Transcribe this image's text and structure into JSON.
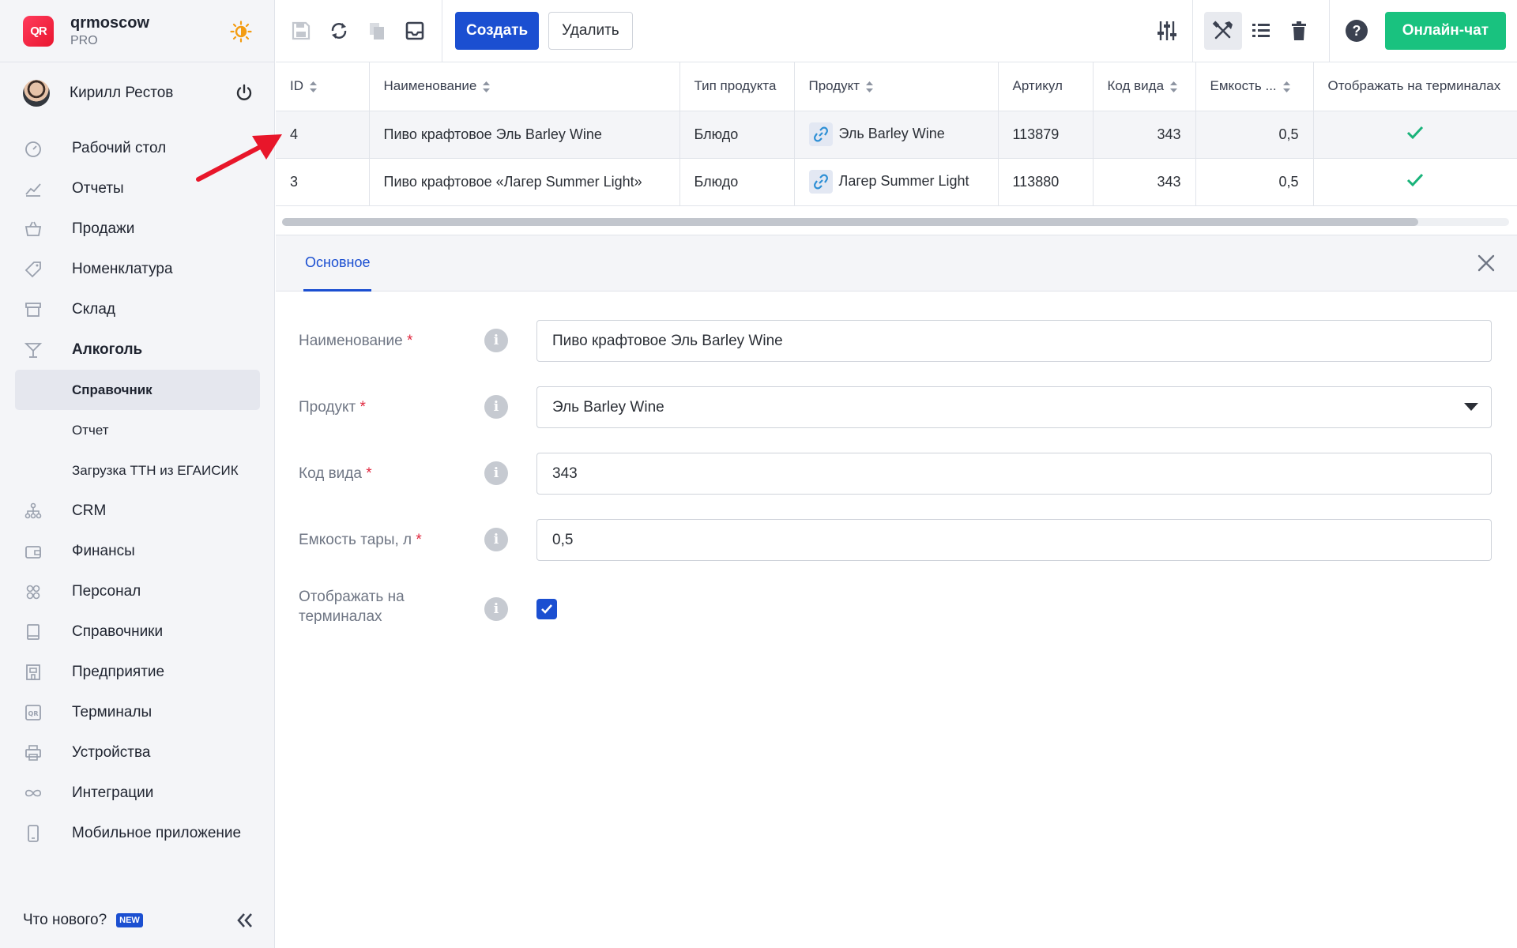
{
  "app": {
    "org_name": "qrmoscow",
    "plan": "PRO",
    "logo_text": "QR",
    "user_name": "Кирилл Рестов"
  },
  "sidebar": {
    "items": [
      {
        "label": "Рабочий стол",
        "icon": "dashboard-icon"
      },
      {
        "label": "Отчеты",
        "icon": "chart-icon"
      },
      {
        "label": "Продажи",
        "icon": "basket-icon"
      },
      {
        "label": "Номенклатура",
        "icon": "tag-icon"
      },
      {
        "label": "Склад",
        "icon": "box-icon"
      },
      {
        "label": "Алкоголь",
        "icon": "cocktail-icon"
      }
    ],
    "sub_items": [
      {
        "label": "Справочник",
        "active": true
      },
      {
        "label": "Отчет",
        "active": false
      },
      {
        "label": "Загрузка ТТН из ЕГАИСИК",
        "active": false
      }
    ],
    "items_after": [
      {
        "label": "CRM",
        "icon": "crm-icon"
      },
      {
        "label": "Финансы",
        "icon": "wallet-icon"
      },
      {
        "label": "Персонал",
        "icon": "people-icon"
      },
      {
        "label": "Справочники",
        "icon": "book-icon"
      },
      {
        "label": "Предприятие",
        "icon": "store-icon"
      },
      {
        "label": "Терминалы",
        "icon": "terminal-icon"
      },
      {
        "label": "Устройства",
        "icon": "printer-icon"
      },
      {
        "label": "Интеграции",
        "icon": "infinity-icon"
      },
      {
        "label": "Мобильное приложение",
        "icon": "phone-icon"
      }
    ],
    "footer": {
      "whats_new": "Что нового?",
      "badge": "NEW"
    }
  },
  "toolbar": {
    "create_label": "Создать",
    "delete_label": "Удалить",
    "chat_label": "Онлайн-чат"
  },
  "table": {
    "columns": [
      "ID",
      "Наименование",
      "Тип продукта",
      "Продукт",
      "Артикул",
      "Код вида",
      "Емкость ...",
      "Отображать на терминалах"
    ],
    "rows": [
      {
        "id": "4",
        "name": "Пиво крафтовое Эль Barley Wine",
        "type": "Блюдо",
        "product": "Эль Barley Wine",
        "article": "113879",
        "code": "343",
        "capacity": "0,5",
        "show": true
      },
      {
        "id": "3",
        "name": "Пиво крафтовое «Лагер Summer Light»",
        "type": "Блюдо",
        "product": "Лагер Summer Light",
        "article": "113880",
        "code": "343",
        "capacity": "0,5",
        "show": true
      }
    ]
  },
  "panel": {
    "tab_label": "Основное",
    "fields": {
      "name_label": "Наименование",
      "name_value": "Пиво крафтовое Эль Barley Wine",
      "product_label": "Продукт",
      "product_value": "Эль Barley Wine",
      "code_label": "Код вида",
      "code_value": "343",
      "capacity_label": "Емкость тары, л",
      "capacity_value": "0,5",
      "show_label": "Отображать на терминалах",
      "show_value": true
    },
    "required_mark": "*",
    "info_glyph": "i"
  },
  "colors": {
    "accent": "#1b4fd1",
    "chat": "#19c27f",
    "check": "#19b37a",
    "required": "#e0263d",
    "annotation": "#e8162a"
  }
}
